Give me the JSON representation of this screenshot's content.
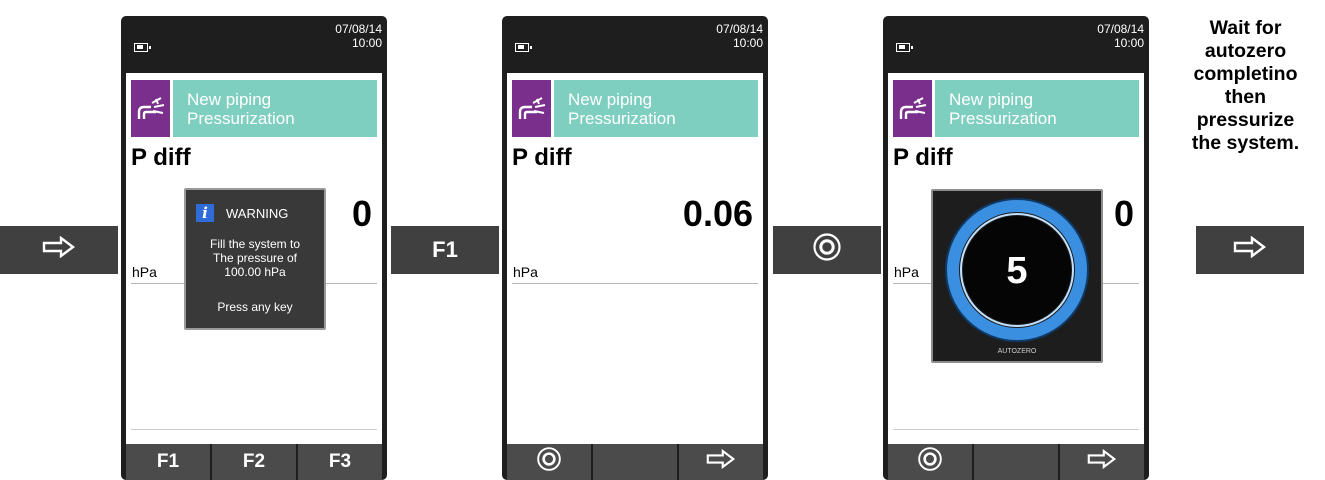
{
  "steps": [
    {
      "date": "07/08/14",
      "time": "10:00",
      "title_line1": "New piping",
      "title_line2": "Pressurization",
      "parameter": "P diff",
      "value": "0",
      "unit": "hPa",
      "warning": {
        "title": "WARNING",
        "line1": "Fill the system to",
        "line2": "The pressure of",
        "line3": "100.00 hPa",
        "prompt": "Press any key"
      },
      "softkeys": [
        "F1",
        "F2",
        "F3"
      ]
    },
    {
      "date": "07/08/14",
      "time": "10:00",
      "title_line1": "New piping",
      "title_line2": "Pressurization",
      "parameter": "P diff",
      "value": "0.06",
      "unit": "hPa",
      "softkeys": [
        "Ⓞ",
        "",
        "⇨"
      ]
    },
    {
      "date": "07/08/14",
      "time": "10:00",
      "title_line1": "New piping",
      "title_line2": "Pressurization",
      "parameter": "P diff",
      "value": "0",
      "unit": "hPa",
      "countdown": "5",
      "countdown_label": "AUTOZERO",
      "softkeys": [
        "Ⓞ",
        "",
        "⇨"
      ]
    }
  ],
  "transitions": [
    {
      "label": "⇨",
      "icon": "right-arrow-icon"
    },
    {
      "label": "F1"
    },
    {
      "label": "Ⓞ",
      "icon": "circle-o-icon"
    },
    {
      "label": "⇨",
      "icon": "right-arrow-icon"
    }
  ],
  "instruction": {
    "lines": [
      "Wait for",
      "autozero",
      "completino",
      "then",
      "pressurize",
      "the system."
    ]
  },
  "colors": {
    "icon_tile": "#7a2f8c",
    "title_bar": "#7ecfc0",
    "transition_box": "#404040",
    "softkey": "#4b4b4b",
    "info_icon": "#2f6cd8",
    "autozero_ring": "#3a8fe0"
  }
}
